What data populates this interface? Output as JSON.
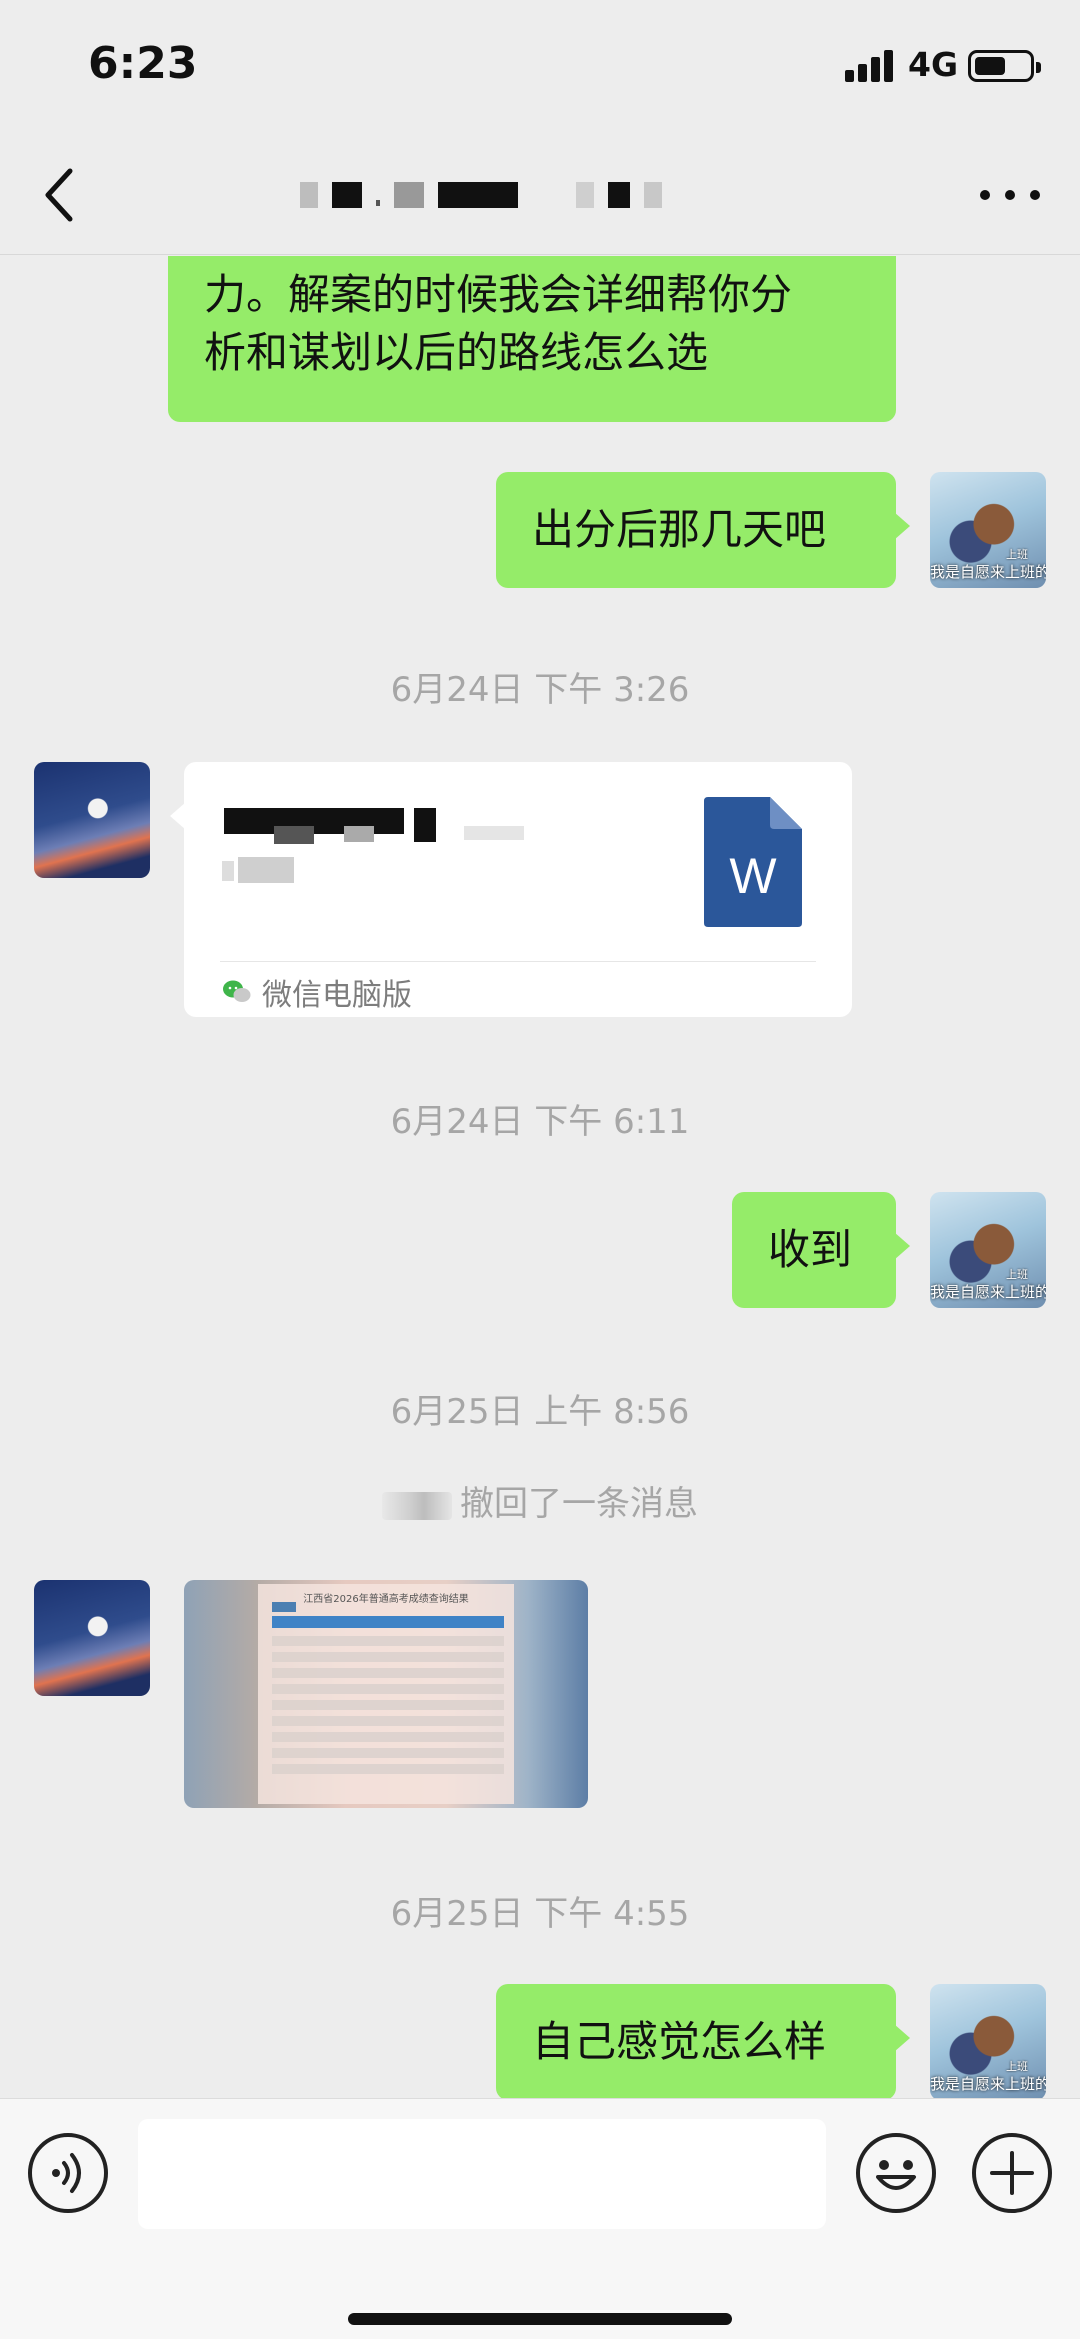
{
  "status_bar": {
    "time": "6:23",
    "network": "4G"
  },
  "nav": {
    "back_icon": "chevron-left-icon",
    "more_icon": "ellipsis-icon"
  },
  "messages": [
    {
      "type": "text",
      "from": "me",
      "text_lines": [
        "力。解案的时候我会详细帮你分",
        "析和谋划以后的路线怎么选"
      ]
    },
    {
      "type": "text",
      "from": "me",
      "text": "出分后那几天吧"
    },
    {
      "type": "timestamp",
      "text": "6月24日 下午 3:26"
    },
    {
      "type": "file",
      "from": "other",
      "source_label": "微信电脑版",
      "file_icon_letter": "W"
    },
    {
      "type": "timestamp",
      "text": "6月24日 下午 6:11"
    },
    {
      "type": "text",
      "from": "me",
      "text": "收到"
    },
    {
      "type": "timestamp",
      "text": "6月25日 上午 8:56"
    },
    {
      "type": "system",
      "text": "撤回了一条消息"
    },
    {
      "type": "image",
      "from": "other",
      "caption": "江西省2026年普通高考成绩查询结果"
    },
    {
      "type": "timestamp",
      "text": "6月25日 下午 4:55"
    },
    {
      "type": "text",
      "from": "me",
      "text": "自己感觉怎么样"
    }
  ],
  "avatar_me": {
    "caption_small": "上班",
    "caption": "我是自愿来上班的"
  },
  "input_bar": {
    "voice_icon": "voice-icon",
    "emoji_icon": "emoji-icon",
    "plus_icon": "plus-icon"
  },
  "colors": {
    "background": "#ededed",
    "my_bubble": "#95ec69",
    "other_bubble": "#ffffff",
    "timestamp_text": "#a6a6a6",
    "word_blue": "#2b579a"
  }
}
